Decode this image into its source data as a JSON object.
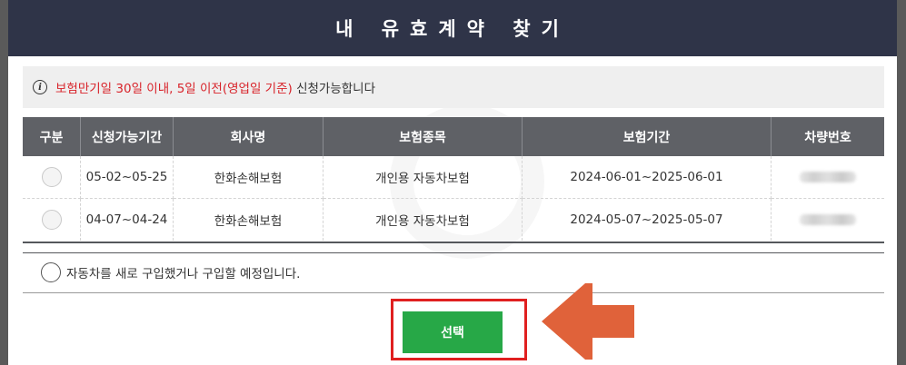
{
  "modal": {
    "title": "내 유효계약 찾기"
  },
  "notice": {
    "icon": "info-icon",
    "highlight_text": "보험만기일 30일 이내, 5일 이전(영업일 기준)",
    "rest_text": " 신청가능합니다",
    "highlight_color": "#d8232a"
  },
  "table": {
    "headers": [
      "구분",
      "신청가능기간",
      "회사명",
      "보험종목",
      "보험기간",
      "차량번호"
    ],
    "rows": [
      {
        "period": "05-02~05-25",
        "company": "한화손해보험",
        "type": "개인용 자동차보험",
        "term": "2024-06-01~2025-06-01"
      },
      {
        "period": "04-07~04-24",
        "company": "한화손해보험",
        "type": "개인용 자동차보험",
        "term": "2024-05-07~2025-05-07"
      }
    ]
  },
  "new_car_option": {
    "label": "자동차를 새로 구입했거나 구입할 예정입니다."
  },
  "select_button": {
    "label": "선택",
    "color": "#27a847"
  },
  "colors": {
    "header_bg": "#2f3448",
    "table_header_bg": "#5f6166",
    "highlight_border": "#e02020",
    "arrow": "#e0623a"
  }
}
